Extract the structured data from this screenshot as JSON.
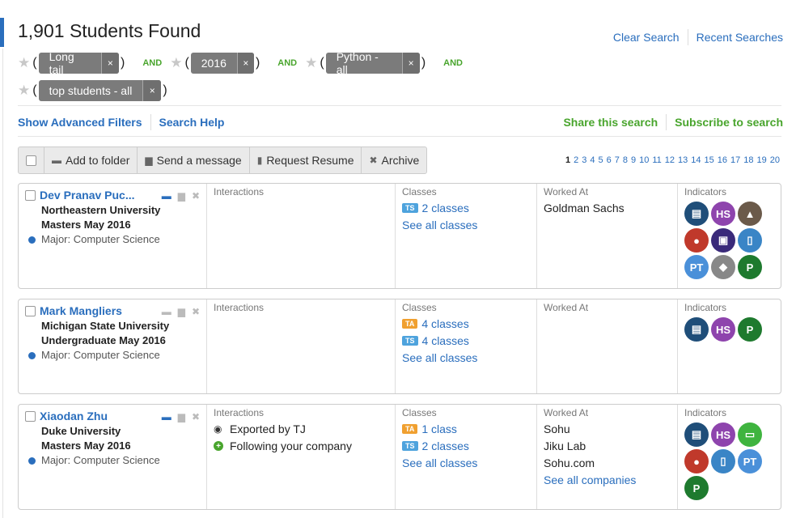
{
  "header": {
    "title": "1,901 Students Found",
    "clear_search": "Clear Search",
    "recent_searches": "Recent Searches"
  },
  "filters": {
    "row1": [
      {
        "label": "Long tail"
      },
      {
        "label": "2016"
      },
      {
        "label": "Python - all"
      }
    ],
    "row2": [
      {
        "label": "top students - all"
      }
    ],
    "and_label": "AND",
    "remove_glyph": "×"
  },
  "links": {
    "advanced": "Show Advanced Filters",
    "help": "Search Help",
    "share": "Share this search",
    "subscribe": "Subscribe to search"
  },
  "toolbar": {
    "add_folder": "Add to folder",
    "send_message": "Send a message",
    "request_resume": "Request Resume",
    "archive": "Archive"
  },
  "pagination": {
    "current": "1",
    "pages": [
      "2",
      "3",
      "4",
      "5",
      "6",
      "7",
      "8",
      "9",
      "10",
      "11",
      "12",
      "13",
      "14",
      "15",
      "16",
      "17",
      "18",
      "19",
      "20"
    ]
  },
  "columns": {
    "interactions": "Interactions",
    "classes": "Classes",
    "worked_at": "Worked At",
    "indicators": "Indicators"
  },
  "see_all_classes": "See all classes",
  "see_all_companies": "See all companies",
  "students": [
    {
      "name": "Dev Pranav Puc...",
      "university": "Northeastern University",
      "degree": "Masters May 2016",
      "major": "Major: Computer Science",
      "interactions": [],
      "classes": [
        {
          "badge": "TS",
          "text": "2 classes"
        }
      ],
      "worked": [
        "Goldman Sachs"
      ],
      "indicators": [
        {
          "name": "transcript-indicator",
          "label": "",
          "color": "#1f4e79"
        },
        {
          "name": "hs-indicator",
          "label": "HS",
          "color": "#8e44ad"
        },
        {
          "name": "hat-indicator",
          "label": "",
          "color": "#6b5a4a"
        },
        {
          "name": "mentor-indicator",
          "label": "",
          "color": "#c0392b"
        },
        {
          "name": "group-indicator",
          "label": "",
          "color": "#3a2a7a"
        },
        {
          "name": "case-indicator",
          "label": "",
          "color": "#3a85c6"
        },
        {
          "name": "pt-indicator",
          "label": "PT",
          "color": "#4a90d9"
        },
        {
          "name": "award-indicator",
          "label": "",
          "color": "#888888"
        },
        {
          "name": "p-indicator",
          "label": "P",
          "color": "#1e7a2e"
        }
      ]
    },
    {
      "name": "Mark Mangliers",
      "university": "Michigan State University",
      "degree": "Undergraduate May 2016",
      "major": "Major: Computer Science",
      "interactions": [],
      "classes": [
        {
          "badge": "TA",
          "text": "4 classes"
        },
        {
          "badge": "TS",
          "text": "4 classes"
        }
      ],
      "worked": [],
      "indicators": [
        {
          "name": "transcript-indicator",
          "label": "",
          "color": "#1f4e79"
        },
        {
          "name": "hs-indicator",
          "label": "HS",
          "color": "#8e44ad"
        },
        {
          "name": "p-indicator",
          "label": "P",
          "color": "#1e7a2e"
        }
      ]
    },
    {
      "name": "Xiaodan Zhu",
      "university": "Duke University",
      "degree": "Masters May 2016",
      "major": "Major: Computer Science",
      "interactions": [
        {
          "icon": "eye-icon",
          "text": "Exported by TJ"
        },
        {
          "icon": "plus-circle-icon",
          "text": "Following your company"
        }
      ],
      "classes": [
        {
          "badge": "TA",
          "text": "1 class"
        },
        {
          "badge": "TS",
          "text": "2 classes"
        }
      ],
      "worked": [
        "Sohu",
        "Jiku Lab",
        "Sohu.com"
      ],
      "indicators": [
        {
          "name": "transcript-indicator",
          "label": "",
          "color": "#1f4e79"
        },
        {
          "name": "hs-indicator",
          "label": "HS",
          "color": "#8e44ad"
        },
        {
          "name": "phone-indicator",
          "label": "",
          "color": "#3fb43f"
        },
        {
          "name": "mentor-indicator",
          "label": "",
          "color": "#c0392b"
        },
        {
          "name": "case-indicator",
          "label": "",
          "color": "#3a85c6"
        },
        {
          "name": "pt-indicator",
          "label": "PT",
          "color": "#4a90d9"
        },
        {
          "name": "p-indicator",
          "label": "P",
          "color": "#1e7a2e"
        }
      ]
    }
  ]
}
